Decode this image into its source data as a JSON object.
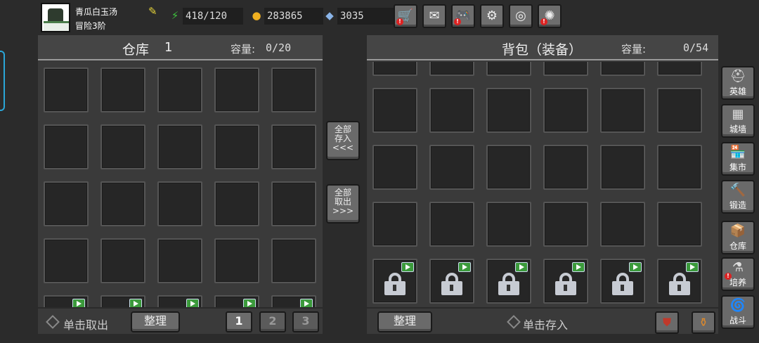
{
  "player": {
    "name": "青瓜白玉汤",
    "rank": "冒险3阶"
  },
  "resources": {
    "energy": "418/120",
    "gold": "283865",
    "gems": "3035"
  },
  "top_buttons": [
    {
      "name": "shop-cart-icon",
      "glyph": "🛒",
      "alert": true
    },
    {
      "name": "mail-icon",
      "glyph": "✉",
      "alert": false
    },
    {
      "name": "gamepad-icon",
      "glyph": "🎮",
      "alert": true
    },
    {
      "name": "settings-gear-icon",
      "glyph": "⚙",
      "alert": false
    },
    {
      "name": "color-wheel-icon",
      "glyph": "◎",
      "alert": false
    },
    {
      "name": "firework-icon",
      "glyph": "✺",
      "alert": true
    }
  ],
  "warehouse": {
    "title": "仓库",
    "number": "1",
    "capacity_label": "容量:",
    "capacity_value": "0/20",
    "hint": "单击取出",
    "sort_label": "整理",
    "pages": [
      "1",
      "2",
      "3"
    ],
    "active_page": "1"
  },
  "transfer": {
    "store_all": [
      "全部",
      "存入",
      "<<<"
    ],
    "take_all": [
      "全部",
      "取出",
      ">>>"
    ]
  },
  "backpack": {
    "title": "背包（装备）",
    "capacity_label": "容量:",
    "capacity_value": "0/54",
    "hint": "单击存入",
    "sort_label": "整理"
  },
  "side_nav": [
    {
      "label": "英雄",
      "glyph": "⛑",
      "alert": false
    },
    {
      "label": "城墙",
      "glyph": "▦",
      "alert": false
    },
    {
      "label": "集市",
      "glyph": "🏪",
      "alert": false
    },
    {
      "label": "锻造",
      "glyph": "🔨",
      "alert": false
    },
    {
      "label": "仓库",
      "glyph": "📦",
      "alert": false
    },
    {
      "label": "培养",
      "glyph": "⚗",
      "alert": true
    },
    {
      "label": "战斗",
      "glyph": "🌀",
      "alert": false
    }
  ],
  "colors": {
    "accent_tab": "#2aa6d8",
    "alert": "#dd2222",
    "ad_badge": "#3b9a3b"
  }
}
